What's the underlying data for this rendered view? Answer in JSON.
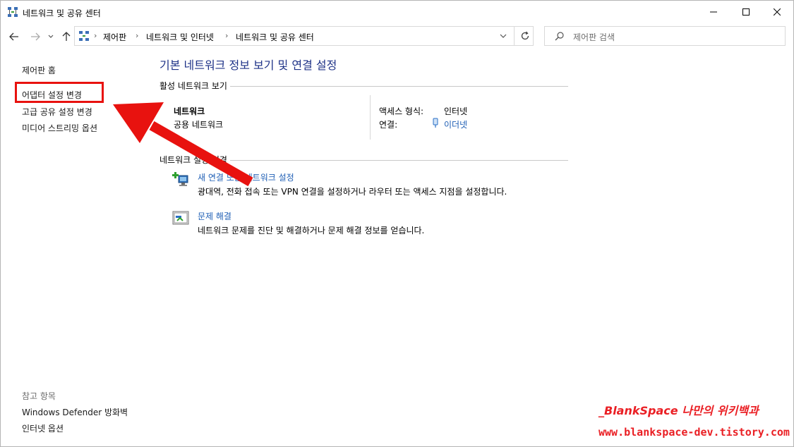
{
  "window": {
    "title": "네트워크 및 공유 센터",
    "icon": "network-sharing-icon"
  },
  "address": {
    "breadcrumbs": [
      "제어판",
      "네트워크 및 인터넷",
      "네트워크 및 공유 센터"
    ],
    "search_placeholder": "제어판 검색"
  },
  "sidebar": {
    "items": [
      "제어판 홈",
      "어댑터 설정 변경",
      "고급 공유 설정 변경",
      "미디어 스트리밍 옵션"
    ],
    "see_also_header": "참고 항목",
    "see_also": [
      "Windows Defender 방화벽",
      "인터넷 옵션"
    ]
  },
  "main": {
    "heading": "기본 네트워크 정보 보기 및 연결 설정",
    "active_section": "활성 네트워크 보기",
    "network_name": "네트워크",
    "network_type": "공용 네트워크",
    "access_label": "액세스 형식:",
    "access_value": "인터넷",
    "connection_label": "연결:",
    "connection_value": "이더넷",
    "change_section": "네트워크 설정 변경",
    "tasks": [
      {
        "link": "새 연결 또는 네트워크 설정",
        "desc": "광대역, 전화 접속 또는 VPN 연결을 설정하거나 라우터 또는 액세스 지점을 설정합니다."
      },
      {
        "link": "문제 해결",
        "desc": "네트워크 문제를 진단 및 해결하거나 문제 해결 정보를 얻습니다."
      }
    ]
  },
  "watermark": {
    "line1": "_BlankSpace 나만의 위키백과",
    "line2": "www.blankspace-dev.tistory.com"
  },
  "colors": {
    "annotation_red": "#e8120f",
    "link_blue": "#1f5fb5",
    "heading_blue": "#1e3287"
  }
}
